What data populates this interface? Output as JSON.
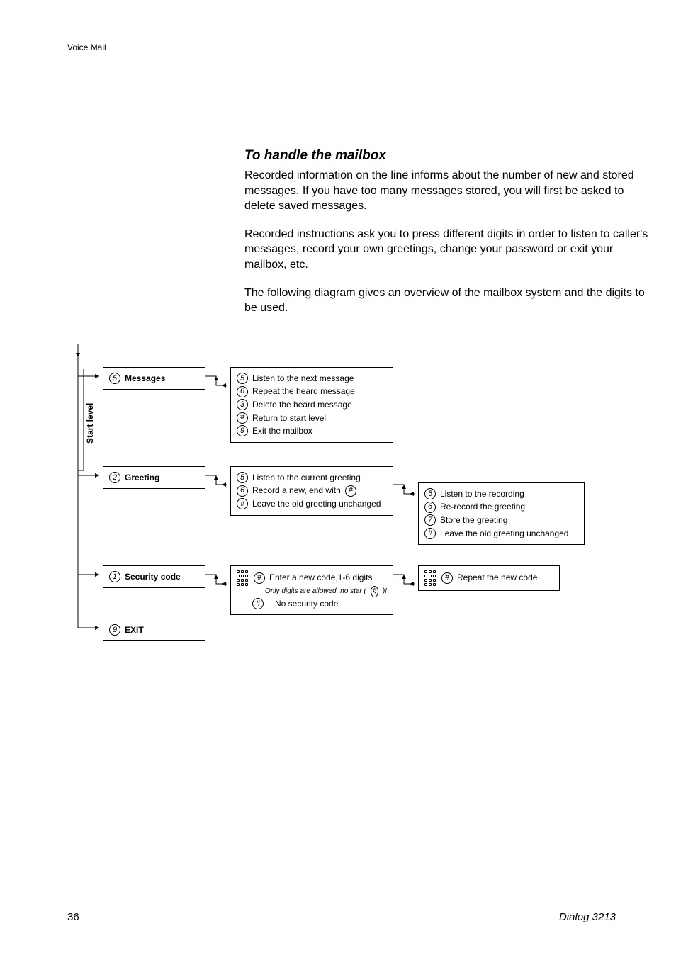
{
  "header": {
    "section": "Voice Mail"
  },
  "content": {
    "heading": "To handle the mailbox",
    "p1": "Recorded information on the line informs about the number of new and stored messages. If you have too many messages stored, you will first be asked to delete saved messages.",
    "p2": "Recorded instructions ask you to press different digits in order to listen to caller's messages, record your own greetings, change your password or exit your mailbox, etc.",
    "p3": "The following diagram gives an overview of the mailbox system and the digits to be used."
  },
  "diagram": {
    "start_label": "Start level",
    "level1": {
      "messages": {
        "digit": "5",
        "label": "Messages"
      },
      "greeting": {
        "digit": "2",
        "label": "Greeting"
      },
      "security": {
        "digit": "1",
        "label": "Security code"
      },
      "exit": {
        "digit": "9",
        "label": "EXIT"
      }
    },
    "messages_sub": {
      "r1": {
        "d": "5",
        "t": "Listen to the next message"
      },
      "r2": {
        "d": "6",
        "t": "Repeat the heard message"
      },
      "r3": {
        "d": "3",
        "t": "Delete the heard message"
      },
      "r4": {
        "d": "#",
        "t": "Return to start level"
      },
      "r5": {
        "d": "9",
        "t": "Exit the mailbox"
      }
    },
    "greeting_sub": {
      "r1": {
        "d": "5",
        "t": "Listen to the current greeting"
      },
      "r2": {
        "d": "6",
        "t": "Record a new, end with",
        "d2": "#"
      },
      "r3": {
        "d": "#",
        "t": "Leave the old greeting unchanged"
      }
    },
    "greeting_sub2": {
      "r1": {
        "d": "5",
        "t": "Listen to the recording"
      },
      "r2": {
        "d": "6",
        "t": "Re-record the greeting"
      },
      "r3": {
        "d": "7",
        "t": "Store the greeting"
      },
      "r4": {
        "d": "#",
        "t": "Leave the old greeting unchanged"
      }
    },
    "security_sub": {
      "r1": {
        "d": "#",
        "t": "Enter a new code,1-6 digits",
        "note": "Only digits are allowed, no star (",
        "note2": ")!"
      },
      "r2": {
        "d": "#",
        "t": "No security code"
      }
    },
    "security_sub2": {
      "r1": {
        "d": "#",
        "t": "Repeat the new code"
      }
    }
  },
  "footer": {
    "page": "36",
    "doc": "Dialog 3213"
  }
}
